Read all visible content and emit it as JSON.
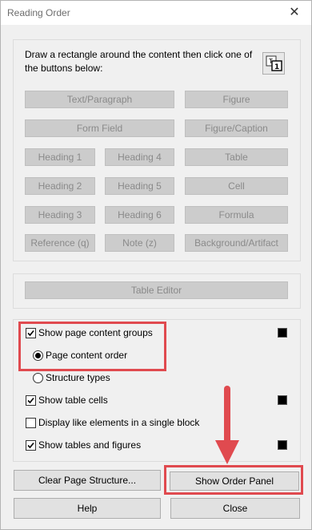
{
  "window": {
    "title": "Reading Order"
  },
  "tagging": {
    "instructions": "Draw a rectangle around the content then click one of the buttons below:",
    "buttons": {
      "text_paragraph": "Text/Paragraph",
      "figure": "Figure",
      "form_field": "Form Field",
      "figure_caption": "Figure/Caption",
      "heading1": "Heading 1",
      "heading4": "Heading 4",
      "table": "Table",
      "heading2": "Heading 2",
      "heading5": "Heading 5",
      "cell": "Cell",
      "heading3": "Heading 3",
      "heading6": "Heading 6",
      "formula": "Formula",
      "reference": "Reference (q)",
      "note": "Note (z)",
      "background_artifact": "Background/Artifact"
    }
  },
  "table_editor": {
    "label": "Table Editor"
  },
  "options": {
    "show_page_content_groups": {
      "label": "Show page content groups",
      "checked": true
    },
    "page_content_order": {
      "label": "Page content order",
      "selected": true
    },
    "structure_types": {
      "label": "Structure types",
      "selected": false
    },
    "show_table_cells": {
      "label": "Show table cells",
      "checked": true
    },
    "display_like_elements": {
      "label": "Display like elements in a single block",
      "checked": false
    },
    "show_tables_figures": {
      "label": "Show tables and figures",
      "checked": true
    }
  },
  "actions": {
    "clear_page_structure": "Clear Page Structure...",
    "show_order_panel": "Show Order Panel",
    "help": "Help",
    "close": "Close"
  },
  "colors": {
    "highlight": "#e04a4f",
    "swatch": "#000000"
  }
}
